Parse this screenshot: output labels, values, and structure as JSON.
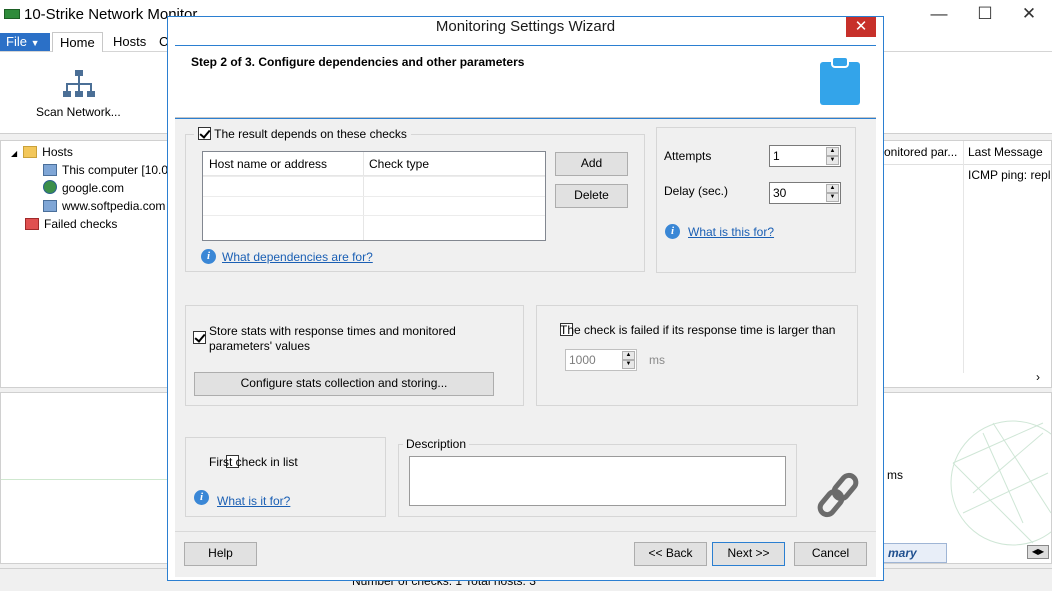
{
  "app": {
    "title": "10-Strike Network Monitor",
    "window_controls": {
      "minimize": "—",
      "maximize": "☐",
      "close": "✕"
    },
    "ribbon": {
      "file_label": "File",
      "tabs": [
        "Home",
        "Hosts",
        "C"
      ],
      "scan_network_label": "Scan Network..."
    },
    "tree": {
      "root_label": "Hosts",
      "items": [
        "This computer [10.0",
        "google.com",
        "www.softpedia.com"
      ],
      "failed_label": "Failed checks"
    },
    "right_table": {
      "col_monitored": "onitored par...",
      "col_last_message": "Last Message",
      "row1_message": "ICMP ping: repl"
    },
    "right_lower": {
      "ms_label": "ms",
      "tab_label": "mary stats"
    },
    "status_text": "Number of checks: 1   Total hosts: 3"
  },
  "dialog": {
    "title": "Monitoring Settings Wizard",
    "close_glyph": "✕",
    "step_title": "Step 2 of 3. Configure dependencies and other parameters",
    "dependencies": {
      "checkbox_label": "The result depends on these checks",
      "checked": true,
      "columns": [
        "Host name or address",
        "Check type"
      ],
      "add_label": "Add",
      "delete_label": "Delete",
      "help_link": "What dependencies are for?"
    },
    "attempts": {
      "attempts_label": "Attempts",
      "attempts_value": "1",
      "delay_label": "Delay (sec.)",
      "delay_value": "30",
      "help_link": "What is this for?"
    },
    "stats": {
      "checkbox_label_line1": "Store stats with response times and monitored",
      "checkbox_label_line2": "parameters' values",
      "checked": true,
      "configure_button": "Configure stats collection and storing..."
    },
    "response_time": {
      "checkbox_label": "The check is failed if its response time is larger than",
      "checked": false,
      "value": "1000",
      "unit": "ms"
    },
    "first_check": {
      "checkbox_label": "First check in list",
      "checked": false,
      "help_link": "What is it for?"
    },
    "description": {
      "label": "Description",
      "value": ""
    },
    "footer": {
      "help": "Help",
      "back": "<< Back",
      "next": "Next >>",
      "cancel": "Cancel"
    }
  }
}
